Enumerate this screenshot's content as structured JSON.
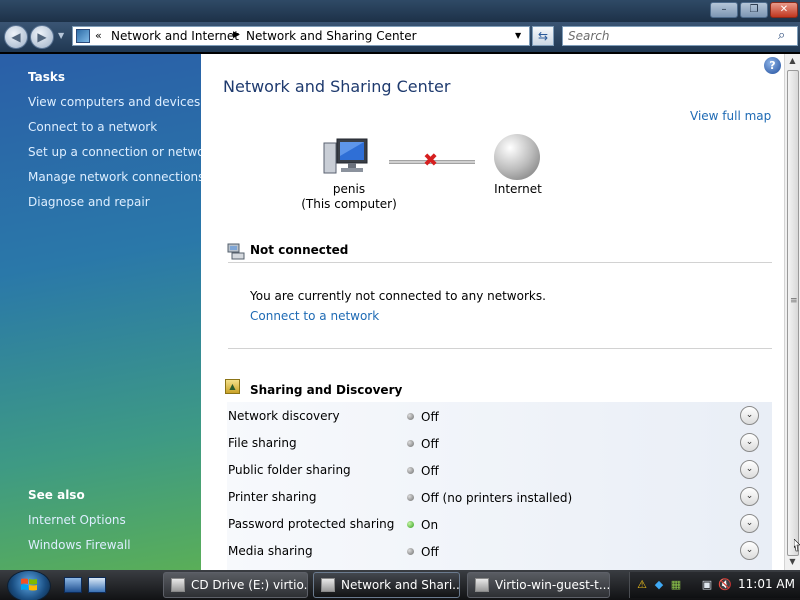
{
  "window": {
    "minimize_glyph": "–",
    "maximize_glyph": "❐",
    "close_glyph": "✕"
  },
  "nav": {
    "back_glyph": "◀",
    "forward_glyph": "▶",
    "history_glyph": "▼",
    "breadcrumb_prefix": "«",
    "breadcrumbs": [
      "Network and Internet",
      "Network and Sharing Center"
    ],
    "crumb_separator": "▶",
    "dropdown_glyph": "▼",
    "refresh_glyph": "⇆",
    "search_placeholder": "Search",
    "search_icon_glyph": "⌕"
  },
  "sidebar": {
    "tasks_title": "Tasks",
    "tasks": [
      "View computers and devices",
      "Connect to a network",
      "Set up a connection or network",
      "Manage network connections",
      "Diagnose and repair"
    ],
    "see_also_title": "See also",
    "see_also": [
      "Internet Options",
      "Windows Firewall"
    ]
  },
  "main": {
    "help_glyph": "?",
    "title": "Network and Sharing Center",
    "view_full_map": "View full map",
    "map": {
      "computer_name": "penis",
      "computer_sub": "(This computer)",
      "disconnect_glyph": "✖",
      "internet_label": "Internet"
    },
    "status": {
      "title": "Not connected",
      "message": "You are currently not connected to any networks.",
      "link": "Connect to a network"
    },
    "sharing": {
      "title": "Sharing and Discovery",
      "expand_glyph": "⌄",
      "rows": [
        {
          "label": "Network discovery",
          "value": "Off",
          "state": "off"
        },
        {
          "label": "File sharing",
          "value": "Off",
          "state": "off"
        },
        {
          "label": "Public folder sharing",
          "value": "Off",
          "state": "off"
        },
        {
          "label": "Printer sharing",
          "value": "Off (no printers installed)",
          "state": "off"
        },
        {
          "label": "Password protected sharing",
          "value": "On",
          "state": "on"
        },
        {
          "label": "Media sharing",
          "value": "Off",
          "state": "off"
        }
      ]
    }
  },
  "scrollbar": {
    "up_glyph": "▲",
    "down_glyph": "▼",
    "grip_glyph": "≡"
  },
  "taskbar": {
    "buttons": [
      {
        "label": "CD Drive (E:) virtio..."
      },
      {
        "label": "Network and Shari..."
      },
      {
        "label": "Virtio-win-guest-t..."
      }
    ],
    "tray_glyphs": [
      "⚠",
      "◆",
      "▦",
      "▣",
      "🔇"
    ],
    "clock": "11:01 AM"
  }
}
